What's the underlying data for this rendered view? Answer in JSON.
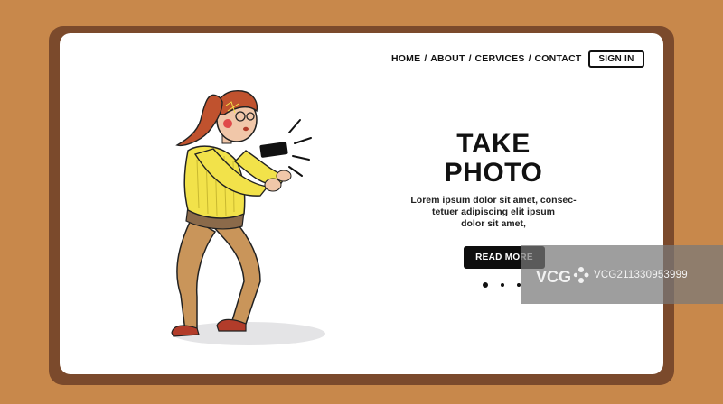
{
  "header": {
    "nav": [
      "HOME",
      "ABOUT",
      "CERVICES",
      "CONTACT"
    ],
    "separator": "/",
    "sign_in": "SIGN IN"
  },
  "hero": {
    "title_line1": "TAKE",
    "title_line2": "PHOTO",
    "body_line1": "Lorem ipsum dolor sit amet, consec-",
    "body_line2": "tetuer adipiscing elit ipsum",
    "body_line3": "dolor sit amet,",
    "cta": "READ MORE",
    "carousel": {
      "count": 3,
      "active_index": 0
    }
  },
  "illustration": {
    "subject": "woman taking photo with smartphone",
    "icon": "woman-photographing-icon"
  },
  "watermark": {
    "logo": "VCG",
    "text": "VCG211330953999"
  },
  "colors": {
    "background": "#C8884B",
    "frame": "#7B4A2C",
    "page": "#FFFFFF",
    "button": "#0E0E0E",
    "sweater": "#F2E24A",
    "pants": "#C9955A",
    "hair": "#C0522E"
  }
}
